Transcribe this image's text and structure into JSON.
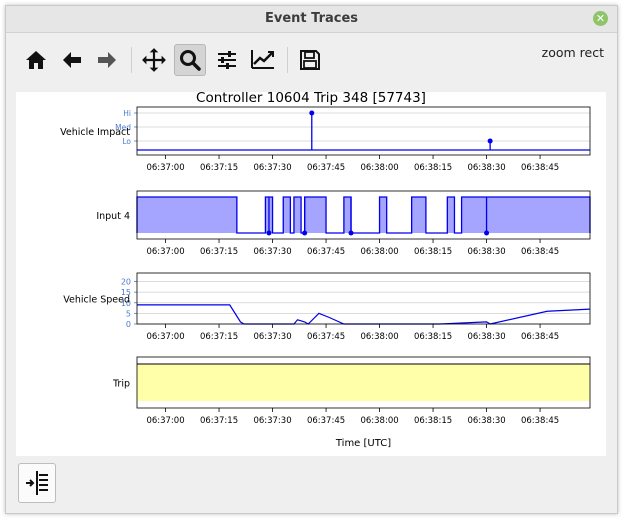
{
  "window": {
    "title": "Event Traces"
  },
  "toolbar": {
    "mode_label": "zoom rect",
    "buttons": [
      {
        "name": "home-icon",
        "active": false
      },
      {
        "name": "back-arrow-icon",
        "active": false
      },
      {
        "name": "forward-arrow-icon",
        "active": false
      },
      {
        "name": "pan-icon",
        "active": false
      },
      {
        "name": "zoom-icon",
        "active": true
      },
      {
        "name": "configure-subplots-icon",
        "active": false
      },
      {
        "name": "edit-axis-icon",
        "active": false
      },
      {
        "name": "save-icon",
        "active": false
      }
    ]
  },
  "chart_data": {
    "type": "line",
    "title": "Controller 10604 Trip 348 [57743]",
    "xlabel": "Time [UTC]",
    "x_ticks": [
      "06:37:00",
      "06:37:15",
      "06:37:30",
      "06:37:45",
      "06:38:00",
      "06:38:15",
      "06:38:30",
      "06:38:45"
    ],
    "x_range": [
      "06:36:52",
      "06:38:59"
    ],
    "panels": [
      {
        "name": "Vehicle Impact",
        "kind": "stem",
        "y_ticks": [
          "Lo",
          "Med",
          "Hi"
        ],
        "y_levels": [
          1,
          2,
          3
        ],
        "events": [
          {
            "t": "06:37:41",
            "level": 3
          },
          {
            "t": "06:38:31",
            "level": 1
          }
        ]
      },
      {
        "name": "Input 4",
        "kind": "step-fill",
        "color": "#a5a5ff",
        "high_intervals": [
          [
            "06:36:52",
            "06:37:20"
          ],
          [
            "06:37:28",
            "06:37:30"
          ],
          [
            "06:37:33",
            "06:37:35"
          ],
          [
            "06:37:36",
            "06:37:38"
          ],
          [
            "06:37:39",
            "06:37:45"
          ],
          [
            "06:37:50",
            "06:37:52"
          ],
          [
            "06:38:00",
            "06:38:02"
          ],
          [
            "06:38:09",
            "06:38:13"
          ],
          [
            "06:38:19",
            "06:38:21"
          ],
          [
            "06:38:23",
            "06:38:59"
          ]
        ],
        "markers": [
          "06:37:29",
          "06:37:39",
          "06:37:52",
          "06:38:30"
        ]
      },
      {
        "name": "Vehicle Speed",
        "kind": "line",
        "y_ticks": [
          0,
          5,
          10,
          15,
          20
        ],
        "ylim": [
          0,
          24
        ],
        "series": [
          {
            "values": [
              [
                "06:36:52",
                9
              ],
              [
                "06:37:18",
                9
              ],
              [
                "06:37:21",
                1
              ],
              [
                "06:37:22",
                0
              ],
              [
                "06:37:36",
                0
              ],
              [
                "06:37:37",
                2
              ],
              [
                "06:37:39",
                1
              ],
              [
                "06:37:40",
                0
              ],
              [
                "06:37:43",
                5
              ],
              [
                "06:37:46",
                3
              ],
              [
                "06:37:50",
                0
              ],
              [
                "06:38:17",
                0
              ],
              [
                "06:38:30",
                1
              ],
              [
                "06:38:31",
                0
              ],
              [
                "06:38:47",
                6
              ],
              [
                "06:38:59",
                7
              ]
            ]
          }
        ]
      },
      {
        "name": "Trip",
        "kind": "span",
        "color": "#ffffaa",
        "interval": [
          "06:36:52",
          "06:38:59"
        ]
      }
    ]
  }
}
